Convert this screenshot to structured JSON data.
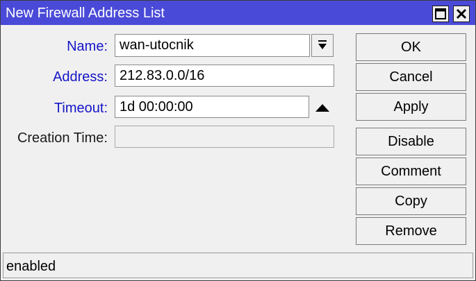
{
  "window": {
    "title": "New Firewall Address List"
  },
  "form": {
    "name": {
      "label": "Name:",
      "value": "wan-utocnik"
    },
    "address": {
      "label": "Address:",
      "value": "212.83.0.0/16"
    },
    "timeout": {
      "label": "Timeout:",
      "value": "1d 00:00:00"
    },
    "creation_time": {
      "label": "Creation Time:",
      "value": ""
    }
  },
  "buttons": {
    "ok": "OK",
    "cancel": "Cancel",
    "apply": "Apply",
    "disable": "Disable",
    "comment": "Comment",
    "copy": "Copy",
    "remove": "Remove"
  },
  "status": {
    "text": "enabled"
  },
  "colors": {
    "titlebar": "#4a4ad8",
    "label_blue": "#1515c8",
    "window_bg": "#f0f0f0"
  },
  "icons": {
    "maximize": "maximize-icon",
    "close": "close-icon",
    "dropdown": "dropdown-arrow-icon",
    "collapse": "triangle-up-icon"
  }
}
